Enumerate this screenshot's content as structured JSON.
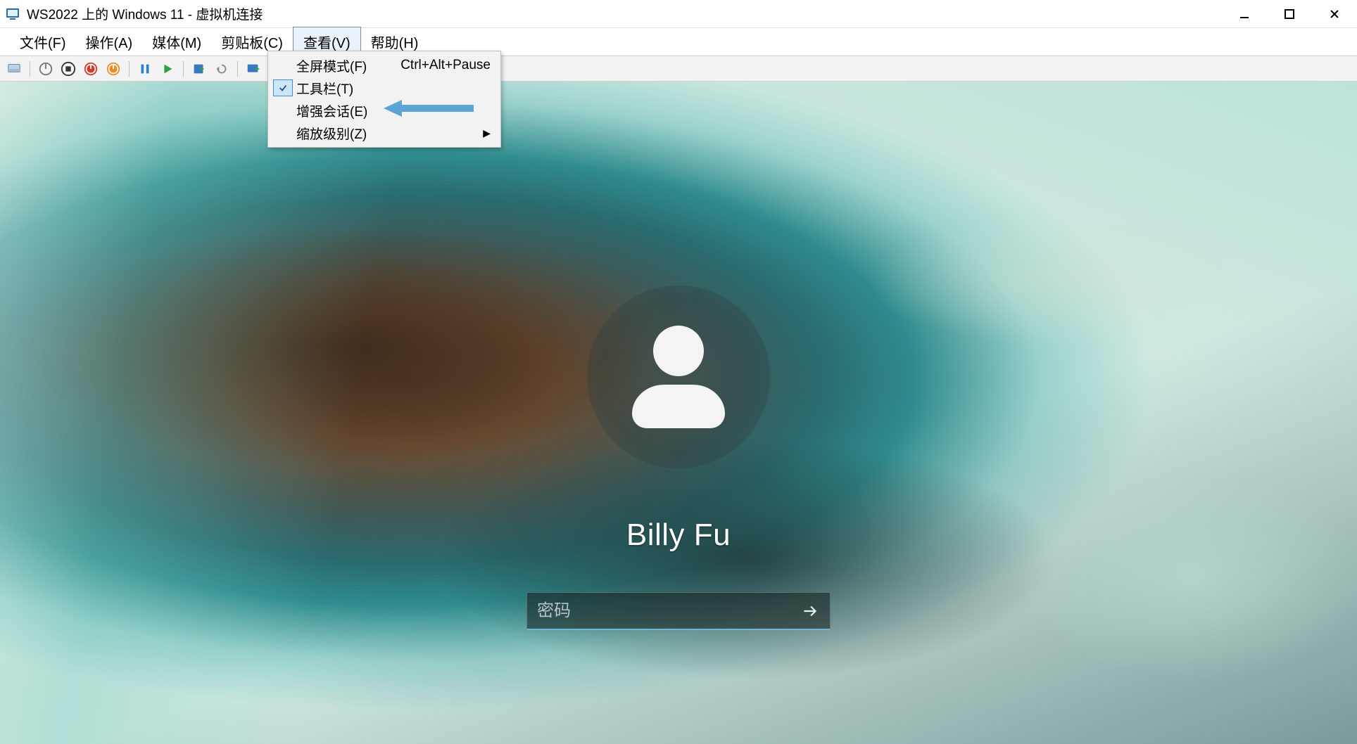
{
  "window": {
    "title": "WS2022 上的 Windows 11 - 虚拟机连接"
  },
  "menubar": {
    "file": "文件(F)",
    "action": "操作(A)",
    "media": "媒体(M)",
    "clipboard": "剪贴板(C)",
    "view": "查看(V)",
    "help": "帮助(H)"
  },
  "view_menu": {
    "fullscreen_label": "全屏模式(F)",
    "fullscreen_shortcut": "Ctrl+Alt+Pause",
    "toolbar_label": "工具栏(T)",
    "enhanced_label": "增强会话(E)",
    "zoom_label": "缩放级别(Z)"
  },
  "toolbar_icons": {
    "ctrl_alt_del": "send-cad-icon",
    "power": "power-icon",
    "stop": "stop-icon",
    "shutdown": "shutdown-icon",
    "reset": "reset-icon",
    "pause": "pause-icon",
    "play": "play-icon",
    "checkpoint": "checkpoint-icon",
    "revert": "revert-icon",
    "enhanced": "enhanced-session-icon"
  },
  "login": {
    "username": "Billy Fu",
    "password_placeholder": "密码"
  },
  "colors": {
    "arrow": "#5ea3d6",
    "accent_underline": "#6fb7d6"
  }
}
